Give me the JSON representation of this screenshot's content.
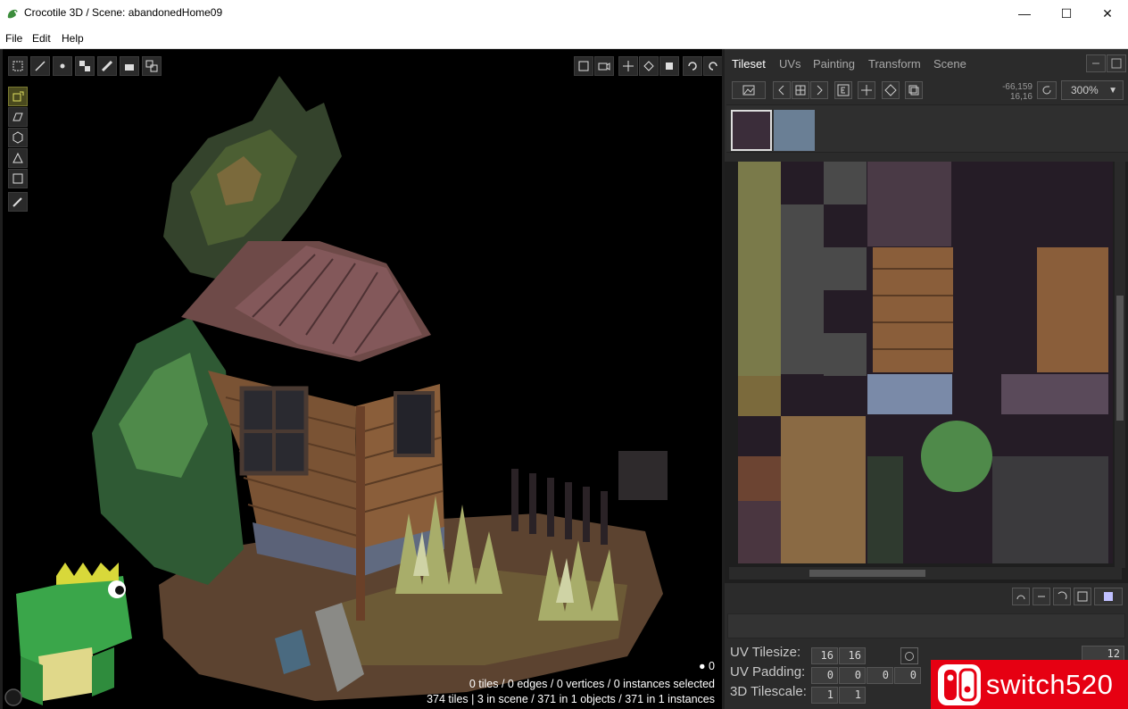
{
  "window": {
    "title": "Crocotile 3D / Scene: abandonedHome09",
    "minimize_glyph": "—",
    "maximize_glyph": "☐",
    "close_glyph": "✕"
  },
  "menu": {
    "file": "File",
    "edit": "Edit",
    "help": "Help"
  },
  "viewport": {
    "history_count": "0",
    "status_selected": "0 tiles / 0 edges / 0 vertices / 0 instances selected",
    "status_totals": "374 tiles | 3 in scene / 371 in 1 objects / 371 in 1 instances"
  },
  "panel": {
    "tabs": [
      "Tileset",
      "UVs",
      "Painting",
      "Transform",
      "Scene"
    ],
    "active_tab": "Tileset",
    "cursor_coords": "-66,159",
    "tile_coords": "16,16",
    "zoom": "300%",
    "uv_tilesize_label": "UV Tilesize:",
    "uv_tilesize": [
      "16",
      "16"
    ],
    "uv_padding_label": "UV Padding:",
    "uv_padding": [
      "0",
      "0",
      "0",
      "0"
    ],
    "tilescale_label": "3D Tilescale:",
    "tilescale": [
      "1",
      "1"
    ],
    "extra_value": "12"
  },
  "watermark": {
    "text": "switch520"
  },
  "colors": {
    "accent": "#e60012",
    "panel": "#2b2b2b",
    "active_tool": "#7a7a30"
  }
}
